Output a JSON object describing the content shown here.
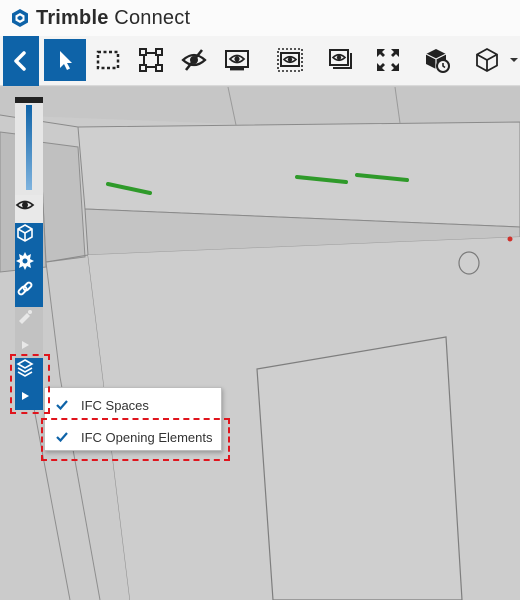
{
  "app": {
    "brand_bold": "Trimble",
    "brand_regular": " Connect",
    "logo_icon": "trimble-logo-icon"
  },
  "toolbar": {
    "buttons": [
      {
        "name": "back",
        "icon": "chevron-left-icon",
        "active": true
      },
      {
        "name": "select",
        "icon": "cursor-icon",
        "active": true
      },
      {
        "name": "box-select",
        "icon": "dashed-rectangle-icon"
      },
      {
        "name": "fit-selection",
        "icon": "selection-frame-icon"
      },
      {
        "name": "hide",
        "icon": "eye-slash-icon"
      },
      {
        "name": "isolate",
        "icon": "eye-frame-icon"
      },
      {
        "name": "show-selected",
        "icon": "eye-dashed-frame-icon"
      },
      {
        "name": "show-all",
        "icon": "eye-stacked-frame-icon"
      },
      {
        "name": "fit-all",
        "icon": "expand-arrows-icon"
      },
      {
        "name": "model-history",
        "icon": "cube-clock-icon"
      },
      {
        "name": "view-cube",
        "icon": "cube-outline-icon"
      }
    ],
    "more_icon": "chevron-down-icon"
  },
  "side_toolbar": {
    "items": [
      "slider",
      "eye-icon",
      "cube-icon",
      "gear-icon",
      "link-icon",
      "paint-icon",
      "play-icon",
      "layers-icon",
      "play-icon"
    ]
  },
  "popup_menu": {
    "items": [
      {
        "label": "IFC Spaces",
        "checked": true
      },
      {
        "label": "IFC Opening Elements",
        "checked": true
      }
    ]
  },
  "colors": {
    "accent": "#0e63a8",
    "highlight": "#e0141c",
    "model_grey": "#c9c9c9",
    "pipe_green": "#2f9a2a"
  }
}
